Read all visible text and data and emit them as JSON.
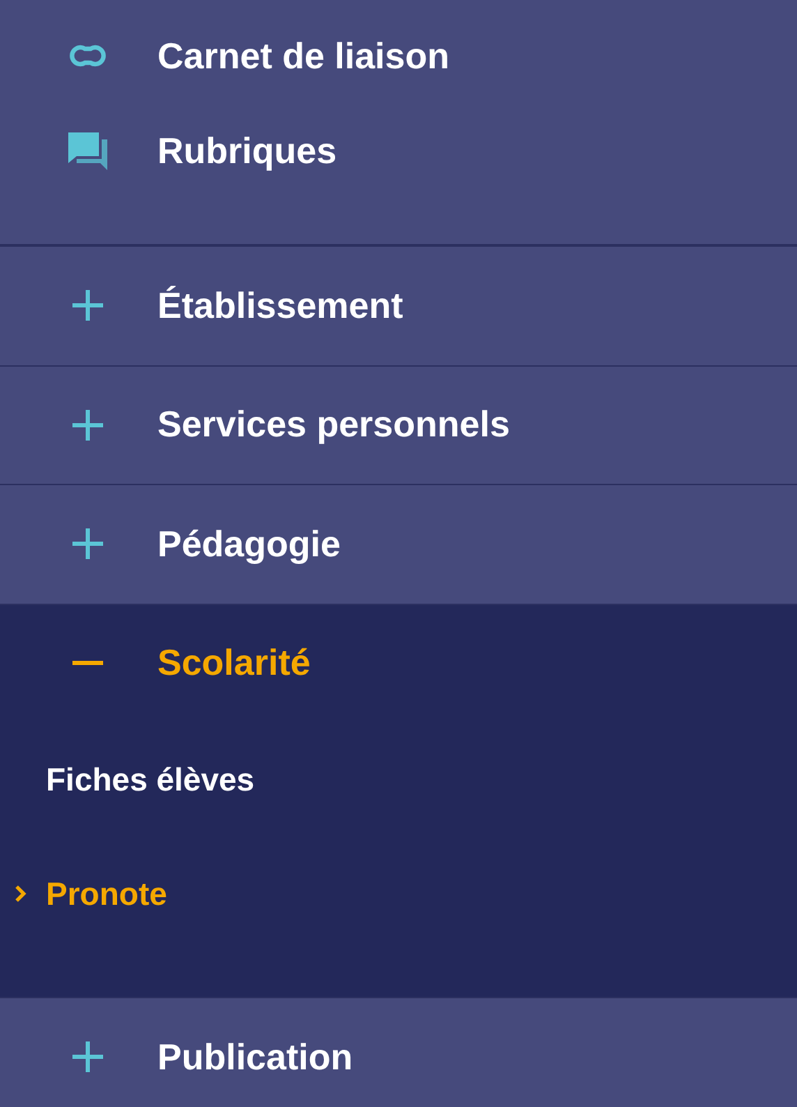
{
  "links": [
    {
      "label": "Carnet de liaison",
      "kind": "link"
    },
    {
      "label": "Rubriques",
      "kind": "chat"
    }
  ],
  "sections": [
    {
      "label": "Établissement",
      "expanded": false
    },
    {
      "label": "Services personnels",
      "expanded": false
    },
    {
      "label": "Pédagogie",
      "expanded": false
    },
    {
      "label": "Scolarité",
      "expanded": true,
      "children": [
        {
          "label": "Fiches élèves",
          "selected": false
        },
        {
          "label": "Pronote",
          "selected": true
        }
      ]
    },
    {
      "label": "Publication",
      "expanded": false
    }
  ]
}
